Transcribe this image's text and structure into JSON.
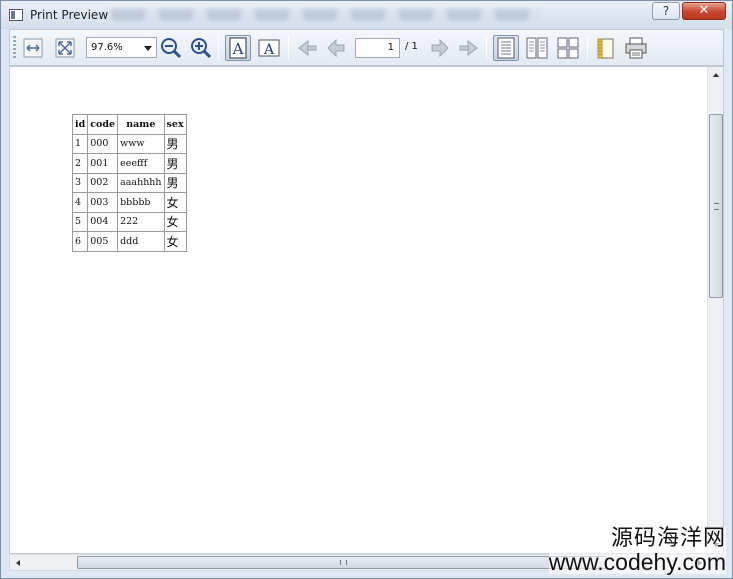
{
  "window": {
    "title": "Print Preview",
    "help_label": "?",
    "close_label": "✕"
  },
  "toolbar": {
    "zoom_value": "97.6%",
    "page_current": "1",
    "page_total": "/ 1",
    "buttons": [
      "fit-width-icon",
      "fit-page-icon",
      "zoom-out-icon",
      "zoom-in-icon",
      "portrait-icon",
      "landscape-icon",
      "first-page-icon",
      "previous-page-icon",
      "next-page-icon",
      "last-page-icon",
      "single-page-icon",
      "facing-pages-icon",
      "overview-icon",
      "page-setup-icon",
      "print-icon"
    ],
    "portrait_glyph": "A",
    "landscape_glyph": "A"
  },
  "table": {
    "headers": [
      "id",
      "code",
      "name",
      "sex"
    ],
    "rows": [
      [
        "1",
        "000",
        "www",
        "男"
      ],
      [
        "2",
        "001",
        "eeefff",
        "男"
      ],
      [
        "3",
        "002",
        "aaahhhh",
        "男"
      ],
      [
        "4",
        "003",
        "bbbbb",
        "女"
      ],
      [
        "5",
        "004",
        "222",
        "女"
      ],
      [
        "6",
        "005",
        "ddd",
        "女"
      ]
    ]
  },
  "watermark": {
    "chinese": "源码海洋网",
    "url": "www.codehy.com"
  }
}
